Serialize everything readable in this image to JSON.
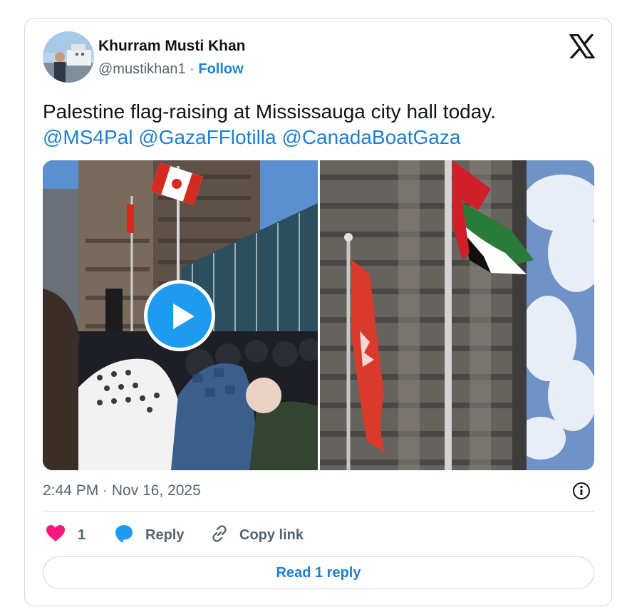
{
  "author": {
    "name": "Khurram Musti Khan",
    "handle": "@mustikhan1",
    "separator": " · ",
    "follow_label": "Follow"
  },
  "tweet": {
    "text": "Palestine flag-raising at Mississauga city hall today.",
    "mentions": [
      "@MS4Pal",
      "@GazaFFlotilla",
      "@CanadaBoatGaza"
    ]
  },
  "media": {
    "items": [
      {
        "kind": "video",
        "icon": "play-icon"
      },
      {
        "kind": "photo"
      }
    ]
  },
  "meta": {
    "timestamp": "2:44 PM · Nov 16, 2025"
  },
  "actions": {
    "like_count": "1",
    "reply_label": "Reply",
    "copy_link_label": "Copy link"
  },
  "read_reply_label": "Read 1 reply",
  "icons": {
    "brand": "x-logo-icon",
    "info": "info-icon",
    "like": "heart-icon",
    "reply": "speech-bubble-icon",
    "copy": "link-icon"
  },
  "colors": {
    "accent": "#1d9bf0",
    "link": "#1d7fd0",
    "like": "#f91880",
    "muted": "#536471",
    "border": "#cfd9de"
  }
}
